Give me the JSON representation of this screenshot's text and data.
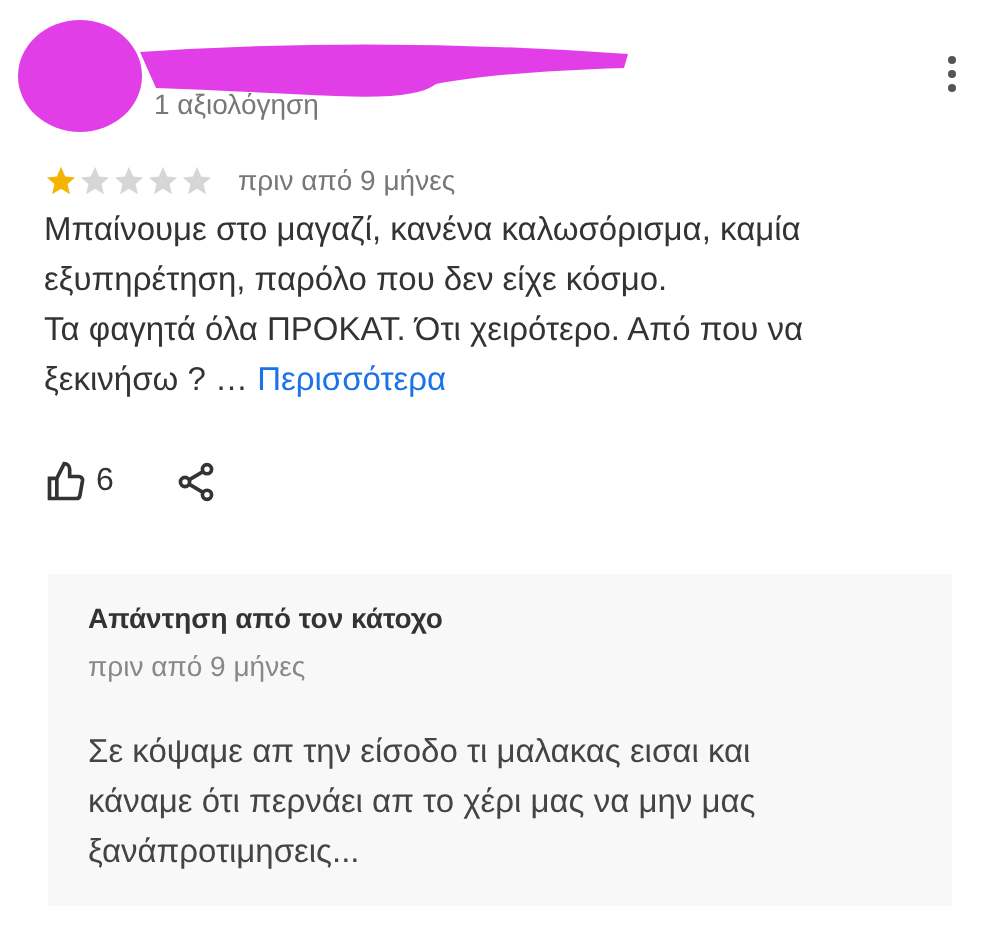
{
  "review": {
    "review_count": "1 αξιολόγηση",
    "stars": 1,
    "time": "πριν από 9 μήνες",
    "paragraphs": [
      "Μπαίνουμε στο μαγαζί, κανένα καλωσόρισμα, καμία εξυπηρέτηση, παρόλο που δεν είχε κόσμο.",
      "Τα φαγητά όλα ΠΡΟΚΑΤ. Ότι χειρότερο. Από που να ξεκινήσω ?"
    ],
    "ellipsis": "…",
    "more_link": "Περισσότερα",
    "likes": "6"
  },
  "owner_reply": {
    "title": "Απάντηση από τον κάτοχο",
    "time": "πριν από 9 μήνες",
    "text": "Σε κόψαμε απ την είσοδο τι μαλακας εισαι και κάναμε ότι περνάει απ το χέρι μας να μην μας ξανάπροτιμησεις..."
  }
}
